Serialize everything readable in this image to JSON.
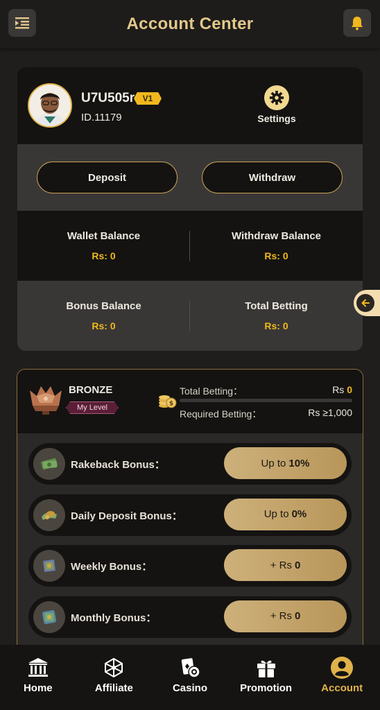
{
  "header": {
    "title": "Account Center",
    "menu_icon": "menu-list-icon",
    "bell_icon": "bell-icon"
  },
  "profile": {
    "username": "U7U505r",
    "vip_badge": "V1",
    "id_text": "ID.11179",
    "settings_label": "Settings"
  },
  "actions": {
    "deposit_label": "Deposit",
    "withdraw_label": "Withdraw"
  },
  "balances": {
    "wallet_label": "Wallet Balance",
    "wallet_value": "Rs: 0",
    "withdraw_label": "Withdraw Balance",
    "withdraw_value": "Rs: 0",
    "bonus_label": "Bonus Balance",
    "bonus_value": "Rs: 0",
    "betting_label": "Total Betting",
    "betting_value": "Rs: 0"
  },
  "level": {
    "name": "BRONZE",
    "my_level_label": "My Level",
    "total_betting_label": "Total Betting：",
    "total_betting_prefix": "Rs",
    "total_betting_value": "0",
    "progress_fraction": 0,
    "required_betting_label": "Required Betting：",
    "required_betting_value": "Rs ≥1,000"
  },
  "bonuses": [
    {
      "label": "Rakeback Bonus：",
      "prefix": "Up to",
      "value": "10%",
      "icon": "rakeback-money-icon"
    },
    {
      "label": "Daily Deposit Bonus：",
      "prefix": "Up to",
      "value": "0%",
      "icon": "daily-deposit-icon"
    },
    {
      "label": "Weekly Bonus：",
      "prefix": "+ Rs",
      "value": "0",
      "icon": "weekly-bonus-icon"
    },
    {
      "label": "Monthly Bonus：",
      "prefix": "+ Rs",
      "value": "0",
      "icon": "monthly-bonus-icon"
    }
  ],
  "tabs": [
    {
      "label": "Home",
      "icon": "bank-icon"
    },
    {
      "label": "Affiliate",
      "icon": "network-icon"
    },
    {
      "label": "Casino",
      "icon": "cards-chip-icon"
    },
    {
      "label": "Promotion",
      "icon": "gift-icon"
    },
    {
      "label": "Account",
      "icon": "user-icon"
    }
  ],
  "colors": {
    "gold": "#e3c88c",
    "accent_yellow": "#f0b81e",
    "active_tab": "#e0b24a"
  }
}
